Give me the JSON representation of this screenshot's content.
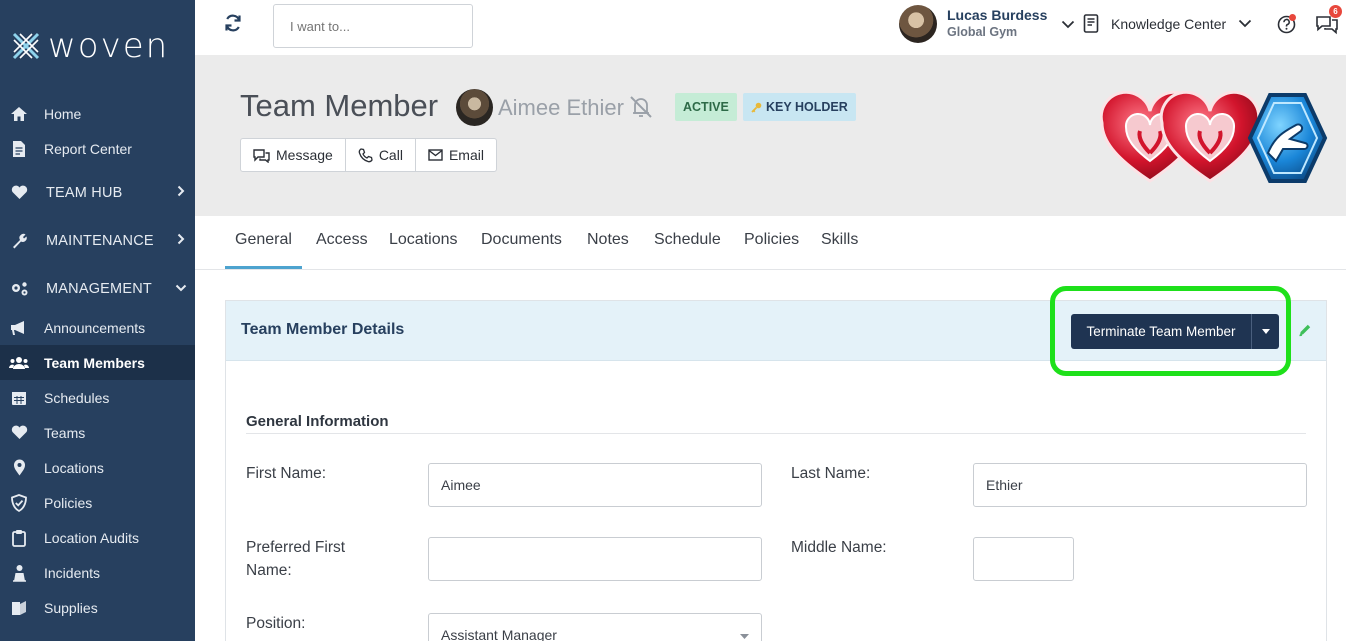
{
  "brand": {
    "name": "woven"
  },
  "sidebar": {
    "items": [
      {
        "label": "Home",
        "icon": "home-icon"
      },
      {
        "label": "Report Center",
        "icon": "report-icon"
      },
      {
        "label": "TEAM HUB",
        "icon": "heart-icon",
        "section": true
      },
      {
        "label": "MAINTENANCE",
        "icon": "wrench-icon",
        "section": true
      },
      {
        "label": "MANAGEMENT",
        "icon": "gears-icon",
        "section": true
      },
      {
        "label": "Announcements",
        "icon": "megaphone-icon"
      },
      {
        "label": "Team Members",
        "icon": "users-icon",
        "active": true
      },
      {
        "label": "Schedules",
        "icon": "calendar-icon"
      },
      {
        "label": "Teams",
        "icon": "heart-icon"
      },
      {
        "label": "Locations",
        "icon": "map-pin-icon"
      },
      {
        "label": "Policies",
        "icon": "shield-icon"
      },
      {
        "label": "Location Audits",
        "icon": "clipboard-icon"
      },
      {
        "label": "Incidents",
        "icon": "person-icon"
      },
      {
        "label": "Supplies",
        "icon": "supplies-icon"
      }
    ]
  },
  "topbar": {
    "search_placeholder": "I want to...",
    "user_name": "Lucas Burdess",
    "user_org": "Global Gym",
    "knowledge_center": "Knowledge Center",
    "notification_count": "6"
  },
  "header": {
    "title": "Team Member",
    "member_name": "Aimee Ethier",
    "status_tag": "ACTIVE",
    "role_tag": "KEY HOLDER",
    "actions": {
      "message": "Message",
      "call": "Call",
      "email": "Email"
    }
  },
  "tabs": [
    "General",
    "Access",
    "Locations",
    "Documents",
    "Notes",
    "Schedule",
    "Policies",
    "Skills"
  ],
  "panel": {
    "title": "Team Member Details",
    "terminate_label": "Terminate Team Member",
    "section_title": "General Information",
    "fields": {
      "first_name_label": "First Name:",
      "first_name_value": "Aimee",
      "last_name_label": "Last Name:",
      "last_name_value": "Ethier",
      "preferred_label_1": "Preferred First",
      "preferred_label_2": "Name:",
      "preferred_value": "",
      "middle_name_label": "Middle Name:",
      "middle_name_value": "",
      "position_label": "Position:",
      "position_value": "Assistant Manager"
    }
  },
  "colors": {
    "sidebar_bg": "#27405f",
    "primary_button": "#1f3452",
    "highlight": "#1ee01a",
    "active_tag_bg": "#c5ecd6",
    "key_tag_bg": "#c8e6f2",
    "tab_underline": "#4da3cf"
  }
}
